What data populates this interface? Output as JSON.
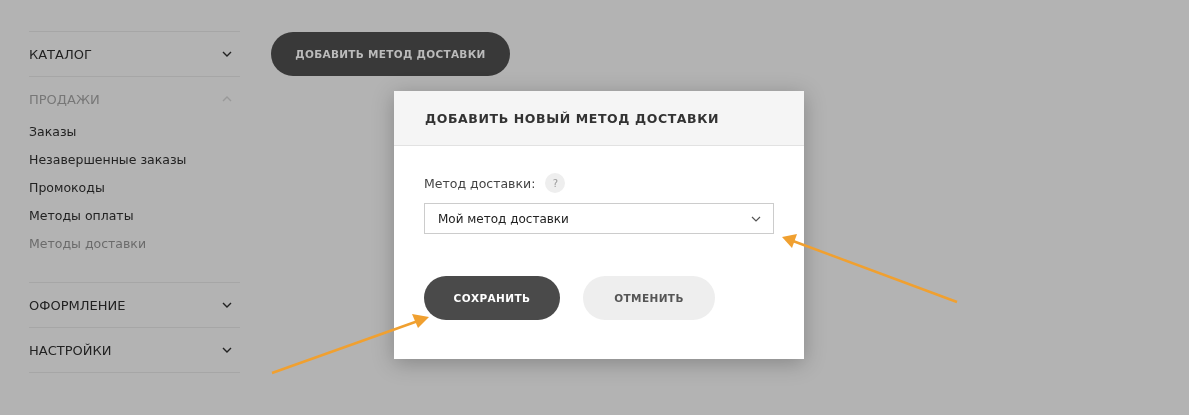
{
  "sidebar": {
    "sections": [
      {
        "label": "КАТАЛОГ",
        "expanded": false
      },
      {
        "label": "ПРОДАЖИ",
        "expanded": true,
        "items": [
          {
            "label": "Заказы",
            "selected": false
          },
          {
            "label": "Незавершенные заказы",
            "selected": false
          },
          {
            "label": "Промокоды",
            "selected": false
          },
          {
            "label": "Методы оплаты",
            "selected": false
          },
          {
            "label": "Методы доставки",
            "selected": true
          }
        ]
      },
      {
        "label": "ОФОРМЛЕНИЕ",
        "expanded": false
      },
      {
        "label": "НАСТРОЙКИ",
        "expanded": false
      }
    ]
  },
  "add_button": "ДОБАВИТЬ МЕТОД ДОСТАВКИ",
  "dialog": {
    "title": "ДОБАВИТЬ НОВЫЙ МЕТОД ДОСТАВКИ",
    "field_label": "Метод доставки:",
    "help": "?",
    "select_value": "Мой метод доставки",
    "buttons": [
      {
        "label": "СОХРАНИТЬ",
        "kind": "primary"
      },
      {
        "label": "ОТМЕНИТЬ",
        "kind": "secondary"
      }
    ]
  }
}
